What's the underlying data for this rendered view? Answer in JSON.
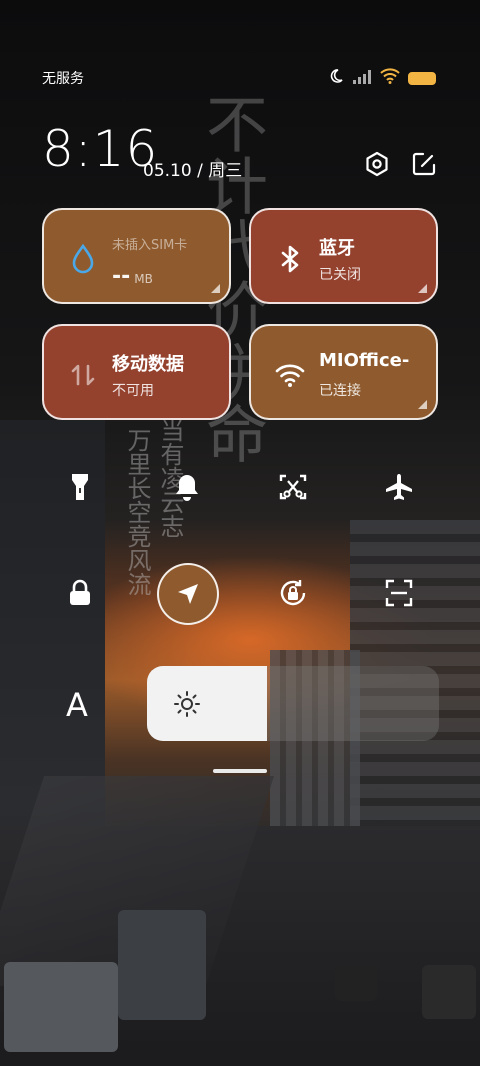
{
  "status_bar": {
    "carrier": "无服务",
    "icons": [
      "moon-icon",
      "signal-icon",
      "wifi-icon",
      "battery-icon"
    ],
    "battery_color": "#f2b544"
  },
  "header": {
    "time": "8:16",
    "date": "05.10 / 周三",
    "buttons": [
      "settings-icon",
      "edit-icon"
    ]
  },
  "tiles": {
    "data_usage": {
      "title": "未插入SIM卡",
      "value": "--",
      "unit": "MB",
      "icon": "water-drop-icon",
      "color": "#8f5b2e"
    },
    "bluetooth": {
      "title": "蓝牙",
      "status": "已关闭",
      "icon": "bluetooth-icon",
      "color": "#94412e"
    },
    "mobile_data": {
      "title": "移动数据",
      "status": "不可用",
      "icon": "data-arrows-icon",
      "color": "#94412e"
    },
    "wifi": {
      "title": "MIOffice-",
      "status": "已连接",
      "icon": "wifi-icon",
      "color": "#8f5b2e"
    }
  },
  "quick_toggles": {
    "row1": [
      "flashlight-icon",
      "bell-icon",
      "screenshot-icon",
      "airplane-icon"
    ],
    "row2": [
      "lock-icon",
      "location-icon",
      "rotation-lock-icon",
      "scanner-icon"
    ],
    "active": [
      "location-icon"
    ]
  },
  "brightness": {
    "level": 0.41,
    "auto_label": "A"
  },
  "wallpaper_calligraphy": {
    "large": "不计代价拼命",
    "small_col1": "万里长空竞风流",
    "small_col2": "当有凌云志"
  }
}
